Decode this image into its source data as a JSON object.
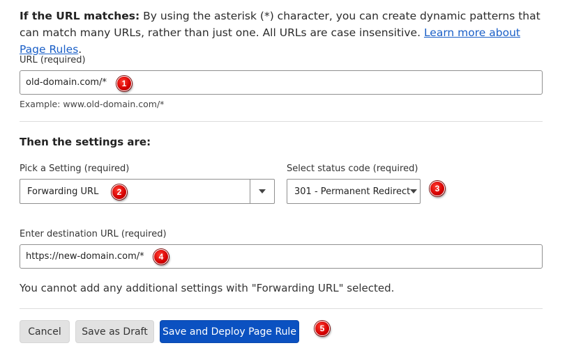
{
  "intro": {
    "bold": "If the URL matches:",
    "text": " By using the asterisk (*) character, you can create dynamic patterns that can match many URLs, rather than just one. All URLs are case insensitive. ",
    "link": "Learn more about Page Rules",
    "end": "."
  },
  "url_field": {
    "label": "URL (required)",
    "value": "old-domain.com/*",
    "example": "Example: www.old-domain.com/*"
  },
  "settings": {
    "heading": "Then the settings are:",
    "pick_label": "Pick a Setting (required)",
    "pick_value": "Forwarding URL",
    "status_label": "Select status code (required)",
    "status_value": "301 - Permanent Redirect"
  },
  "destination": {
    "label": "Enter destination URL (required)",
    "value": "https://new-domain.com/*"
  },
  "note": "You cannot add any additional settings with \"Forwarding URL\" selected.",
  "buttons": {
    "cancel": "Cancel",
    "draft": "Save as Draft",
    "deploy": "Save and Deploy Page Rule"
  },
  "badges": [
    "1",
    "2",
    "3",
    "4",
    "5"
  ],
  "colors": {
    "primary": "#0b51c1",
    "link": "#1a5fc7",
    "badge": "#d40000"
  }
}
